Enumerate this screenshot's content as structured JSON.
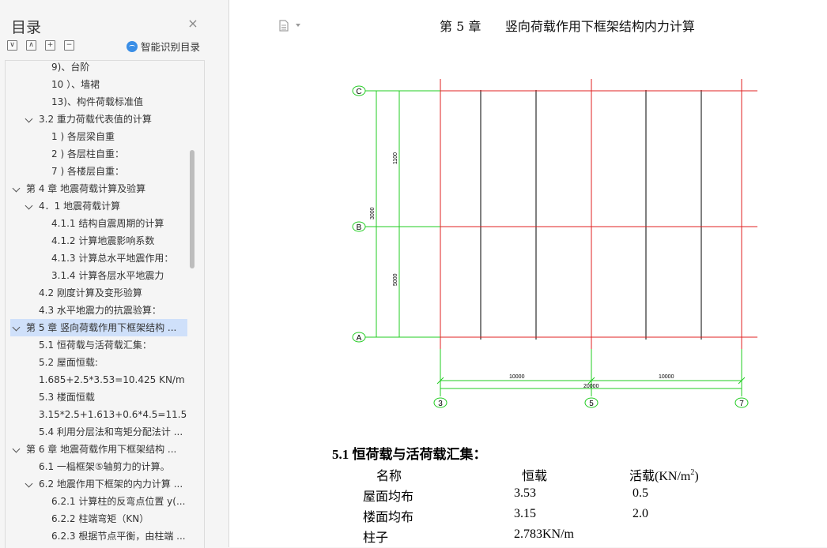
{
  "sidebar": {
    "title": "目录",
    "close_glyph": "×",
    "tools": {
      "expand_glyph": "∨",
      "collapse_glyph": "∧",
      "add_glyph": "+",
      "remove_glyph": "−"
    },
    "smart_label": "智能识别目录",
    "items": [
      {
        "label": "9)、台阶",
        "level": 3,
        "chevron": ""
      },
      {
        "label": "10 ）、墙裙",
        "level": 3,
        "chevron": ""
      },
      {
        "label": "13)、构件荷载标准值",
        "level": 3,
        "chevron": ""
      },
      {
        "label": "3.2 重力荷载代表值的计算",
        "level": 2,
        "chevron": "down"
      },
      {
        "label": "1 ) 各层梁自重",
        "level": 3,
        "chevron": ""
      },
      {
        "label": "2 ) 各层柱自重：",
        "level": 3,
        "chevron": ""
      },
      {
        "label": "7 ) 各楼层自重：",
        "level": 3,
        "chevron": ""
      },
      {
        "label": "第 4 章  地震荷载计算及验算",
        "level": 1,
        "chevron": "down"
      },
      {
        "label": "4．1 地震荷载计算",
        "level": 2,
        "chevron": "down"
      },
      {
        "label": "4.1.1 结构自震周期的计算",
        "level": 3,
        "chevron": ""
      },
      {
        "label": "4.1.2 计算地震影响系数",
        "level": 3,
        "chevron": ""
      },
      {
        "label": "4.1.3 计算总水平地震作用：",
        "level": 3,
        "chevron": ""
      },
      {
        "label": "3.1.4 计算各层水平地震力",
        "level": 3,
        "chevron": ""
      },
      {
        "label": "4.2 刚度计算及变形验算",
        "level": 2,
        "chevron": ""
      },
      {
        "label": "4.3 水平地震力的抗震验算：",
        "level": 2,
        "chevron": ""
      },
      {
        "label": "第 5 章      竖向荷载作用下框架结构 ...",
        "level": 1,
        "chevron": "down",
        "selected": true
      },
      {
        "label": "5.1 恒荷载与活荷载汇集：",
        "level": 2,
        "chevron": ""
      },
      {
        "label": "5.2 屋面恒载:",
        "level": 2,
        "chevron": ""
      },
      {
        "label": "1.685+2.5*3.53=10.425 KN/m",
        "level": 2,
        "chevron": ""
      },
      {
        "label": "5.3 楼面恒载",
        "level": 2,
        "chevron": ""
      },
      {
        "label": "3.15*2.5+1.613+0.6*4.5=11.5 ...",
        "level": 2,
        "chevron": ""
      },
      {
        "label": "5.4 利用分层法和弯矩分配法计 ...",
        "level": 2,
        "chevron": ""
      },
      {
        "label": "第 6 章   地震荷载作用下框架结构 ...",
        "level": 1,
        "chevron": "down"
      },
      {
        "label": "6.1 一榀框架⑤轴剪力的计算。",
        "level": 2,
        "chevron": ""
      },
      {
        "label": "6.2 地震作用下框架的内力计算 ...",
        "level": 2,
        "chevron": "down"
      },
      {
        "label": "6.2.1 计算柱的反弯点位置 y(...",
        "level": 3,
        "chevron": ""
      },
      {
        "label": "6.2.2 柱端弯矩（KN）",
        "level": 3,
        "chevron": ""
      },
      {
        "label": "6.2.3 根据节点平衡，由柱端 ...",
        "level": 3,
        "chevron": ""
      }
    ]
  },
  "document": {
    "chapter_header": "第 5 章      竖向荷载作用下框架结构内力计算",
    "drawing": {
      "axis_labels": {
        "C": "C",
        "B": "B",
        "A": "A",
        "n3": "3",
        "n5": "5",
        "n7": "7"
      },
      "dims": {
        "d1100": "1100",
        "d3000": "3000",
        "d5000": "5000",
        "d10000a": "10000",
        "d10000b": "10000",
        "d20000": "20000"
      },
      "colors": {
        "grid_red": "#e02020",
        "dim_green": "#22cc22",
        "black": "#000000"
      }
    },
    "section_heading": "5.1 恒荷载与活荷载汇集：",
    "table": {
      "headers": {
        "name": "名称",
        "dead": "恒载",
        "live": "活载(KN/m",
        "live_sup": "2",
        "live_close": ")"
      },
      "rows": [
        {
          "name": "屋面均布",
          "dead": "3.53",
          "live": "0.5"
        },
        {
          "name": "楼面均布",
          "dead": "3.15",
          "live": "2.0"
        },
        {
          "name": "柱子",
          "dead": "2.783KN/m",
          "live": ""
        }
      ]
    }
  }
}
